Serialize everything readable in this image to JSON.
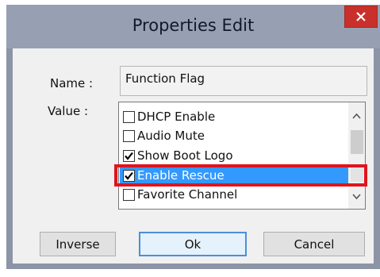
{
  "dialog": {
    "title": "Properties Edit",
    "close_icon": "close-icon",
    "name_label": "Name :",
    "name_value": "Function Flag",
    "value_label": "Value :",
    "items": [
      {
        "label": "DHCP Enable",
        "checked": false,
        "selected": false
      },
      {
        "label": "Audio Mute",
        "checked": false,
        "selected": false
      },
      {
        "label": "Show Boot Logo",
        "checked": true,
        "selected": false
      },
      {
        "label": "Enable Rescue",
        "checked": true,
        "selected": true
      },
      {
        "label": "Favorite Channel",
        "checked": false,
        "selected": false
      }
    ],
    "buttons": {
      "inverse": "Inverse",
      "ok": "Ok",
      "cancel": "Cancel"
    }
  },
  "colors": {
    "titlebar": "#96a0b2",
    "close_button": "#c9302c",
    "selection": "#3399ff",
    "annotation_box": "#e0141e"
  }
}
